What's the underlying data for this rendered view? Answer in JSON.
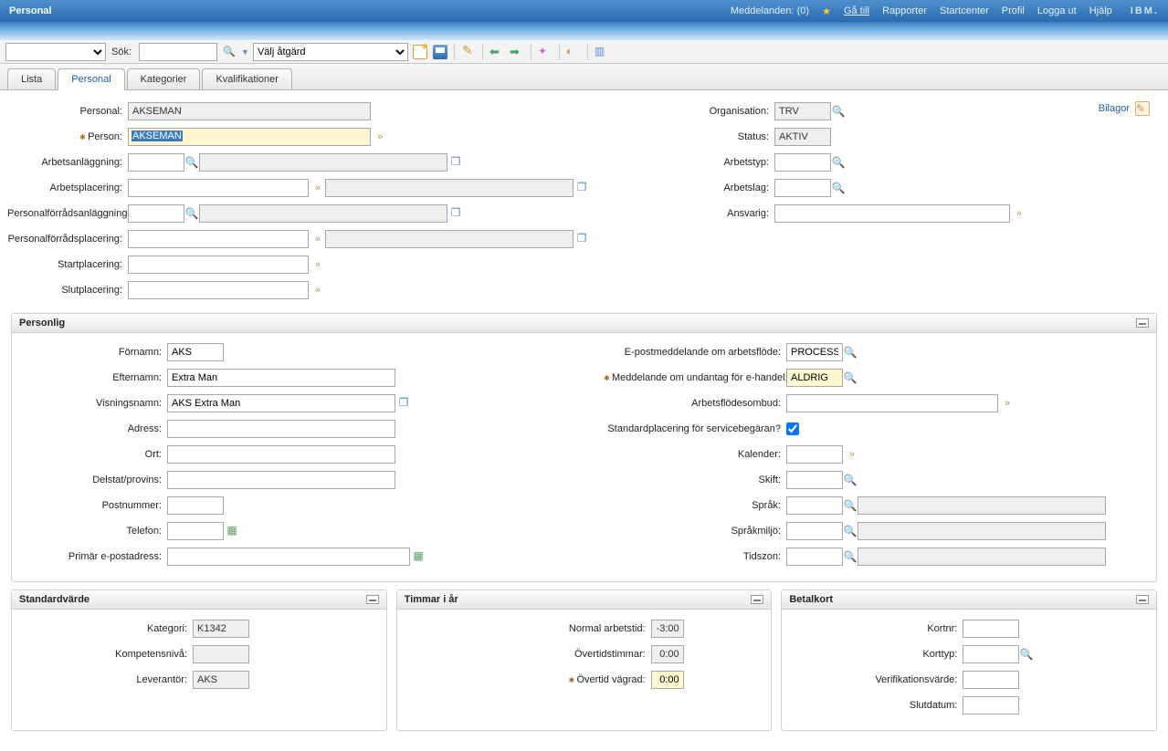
{
  "header": {
    "title": "Personal",
    "messages": "Meddelanden: (0)",
    "goto": "Gå till",
    "links": [
      "Rapporter",
      "Startcenter",
      "Profil",
      "Logga ut",
      "Hjälp"
    ],
    "logo": "IBM."
  },
  "toolbar": {
    "search_label": "Sök:",
    "action_placeholder": "Välj åtgärd"
  },
  "tabs": [
    "Lista",
    "Personal",
    "Kategorier",
    "Kvalifikationer"
  ],
  "active_tab": "Personal",
  "attach_label": "Bilagor",
  "top": {
    "labels": {
      "personal": "Personal:",
      "person": "Person:",
      "arbetsanlaggning": "Arbetsanläggning:",
      "arbetsplacering": "Arbetsplacering:",
      "pfa": "Personalförrådsanläggning:",
      "pfp": "Personalförrådsplacering:",
      "startplacering": "Startplacering:",
      "slutplacering": "Slutplacering:",
      "organisation": "Organisation:",
      "status": "Status:",
      "arbetstyp": "Arbetstyp:",
      "arbetslag": "Arbetslag:",
      "ansvarig": "Ansvarig:"
    },
    "values": {
      "personal": "AKSEMAN",
      "person": "AKSEMAN",
      "organisation": "TRV",
      "status": "AKTIV"
    }
  },
  "personlig": {
    "title": "Personlig",
    "labels": {
      "fornamn": "Förnamn:",
      "efternamn": "Efternamn:",
      "visningsnamn": "Visningsnamn:",
      "adress": "Adress:",
      "ort": "Ort:",
      "delstat": "Delstat/provins:",
      "postnummer": "Postnummer:",
      "telefon": "Telefon:",
      "epost": "Primär e-postadress:",
      "epost_arbetsflode": "E-postmeddelande om arbetsflöde:",
      "undantag_ehandel": "Meddelande om undantag för e-handel:",
      "arbetsflodesombud": "Arbetsflödesombud:",
      "stdplacering": "Standardplacering för servicebegäran?",
      "kalender": "Kalender:",
      "skift": "Skift:",
      "sprak": "Språk:",
      "sprakmiljo": "Språkmiljö:",
      "tidszon": "Tidszon:"
    },
    "values": {
      "fornamn": "AKS",
      "efternamn": "Extra Man",
      "visningsnamn": "AKS Extra Man",
      "epost_arbetsflode": "PROCESS",
      "undantag_ehandel": "ALDRIG",
      "stdplacering_checked": true
    }
  },
  "standardvarde": {
    "title": "Standardvärde",
    "labels": {
      "kategori": "Kategori:",
      "kompetensniva": "Kompetensnivå:",
      "leverantor": "Leverantör:"
    },
    "values": {
      "kategori": "K1342",
      "leverantor": "AKS"
    }
  },
  "timmar": {
    "title": "Timmar i år",
    "labels": {
      "normal": "Normal arbetstid:",
      "overtid": "Övertidstimmar:",
      "vagrad": "Övertid vägrad:"
    },
    "values": {
      "normal": "-3:00",
      "overtid": "0:00",
      "vagrad": "0:00"
    }
  },
  "betalkort": {
    "title": "Betalkort",
    "labels": {
      "kortnr": "Kortnr:",
      "korttyp": "Korttyp:",
      "verif": "Verifikationsvärde:",
      "slutdatum": "Slutdatum:"
    }
  }
}
